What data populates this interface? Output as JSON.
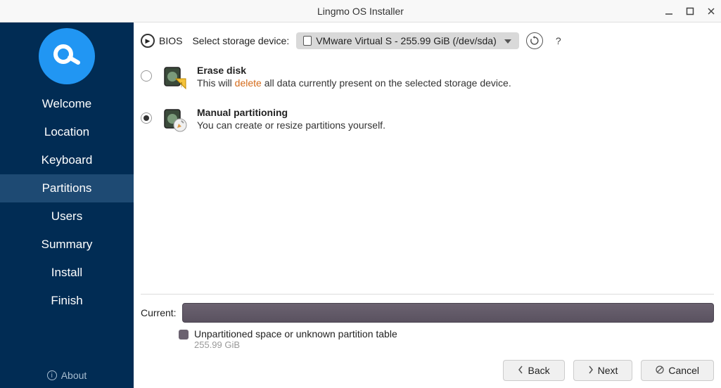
{
  "window": {
    "title": "Lingmo OS Installer"
  },
  "sidebar": {
    "items": [
      {
        "label": "Welcome"
      },
      {
        "label": "Location"
      },
      {
        "label": "Keyboard"
      },
      {
        "label": "Partitions"
      },
      {
        "label": "Users"
      },
      {
        "label": "Summary"
      },
      {
        "label": "Install"
      },
      {
        "label": "Finish"
      }
    ],
    "active_index": 3,
    "about_label": "About"
  },
  "top": {
    "bios_label": "BIOS",
    "select_label": "Select storage device:",
    "device_label": "VMware Virtual S - 255.99 GiB (/dev/sda)",
    "help_label": "?"
  },
  "options": {
    "selected_index": 1,
    "erase": {
      "title": "Erase disk",
      "desc_pre": "This will ",
      "delete_word": "delete",
      "desc_post": " all data currently present on the selected storage device."
    },
    "manual": {
      "title": "Manual partitioning",
      "desc": "You can create or resize partitions yourself."
    }
  },
  "current": {
    "label": "Current:",
    "legend_title": "Unpartitioned space or unknown partition table",
    "legend_size": "255.99 GiB",
    "legend_color": "#6b6270"
  },
  "buttons": {
    "back": "Back",
    "next": "Next",
    "cancel": "Cancel"
  }
}
